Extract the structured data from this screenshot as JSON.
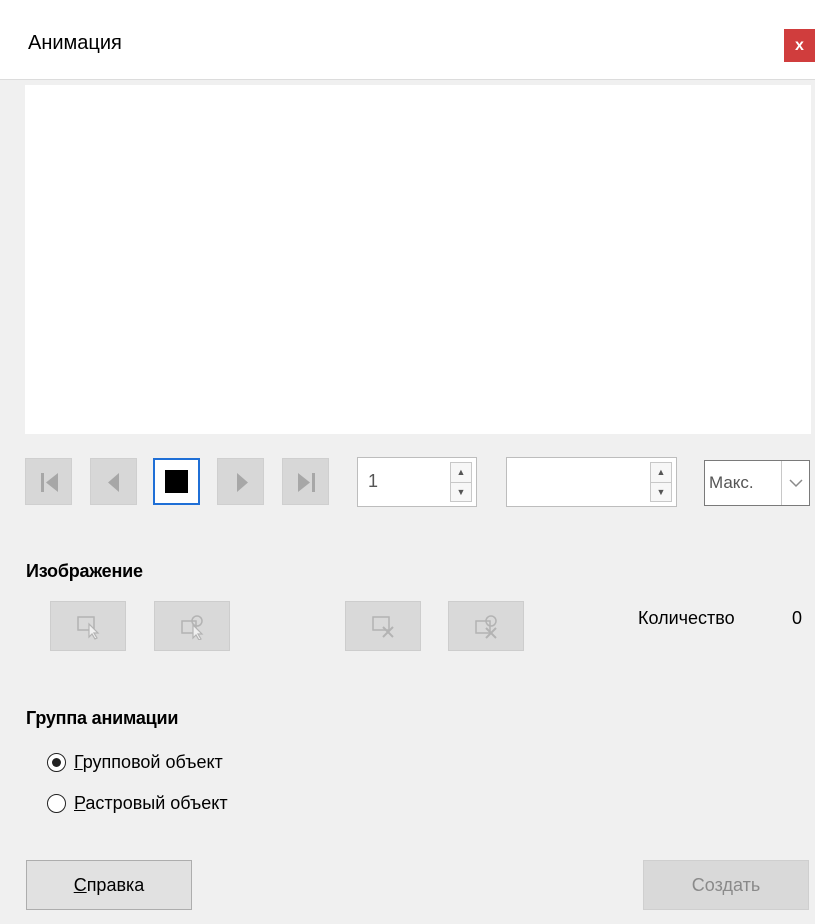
{
  "window": {
    "title": "Анимация",
    "close_label": "x"
  },
  "playback": {
    "frame_value": "1",
    "duration_value": "",
    "loop_value": "Макс."
  },
  "image_section": {
    "title": "Изображение",
    "count_label": "Количество",
    "count_value": "0"
  },
  "group_section": {
    "title": "Группа анимации",
    "options": [
      {
        "mnemonic": "Г",
        "rest": "рупповой объект",
        "checked": true
      },
      {
        "mnemonic": "Р",
        "rest": "астровый объект",
        "checked": false
      }
    ]
  },
  "buttons": {
    "help_mnemonic": "С",
    "help_rest": "правка",
    "create_label": "Создать"
  },
  "icons": {
    "first": "skip-first-icon",
    "prev": "play-reverse-icon",
    "stop": "stop-icon",
    "play": "play-icon",
    "last": "skip-last-icon"
  },
  "colors": {
    "accent": "#1f6fd6",
    "close": "#d03d3d"
  }
}
